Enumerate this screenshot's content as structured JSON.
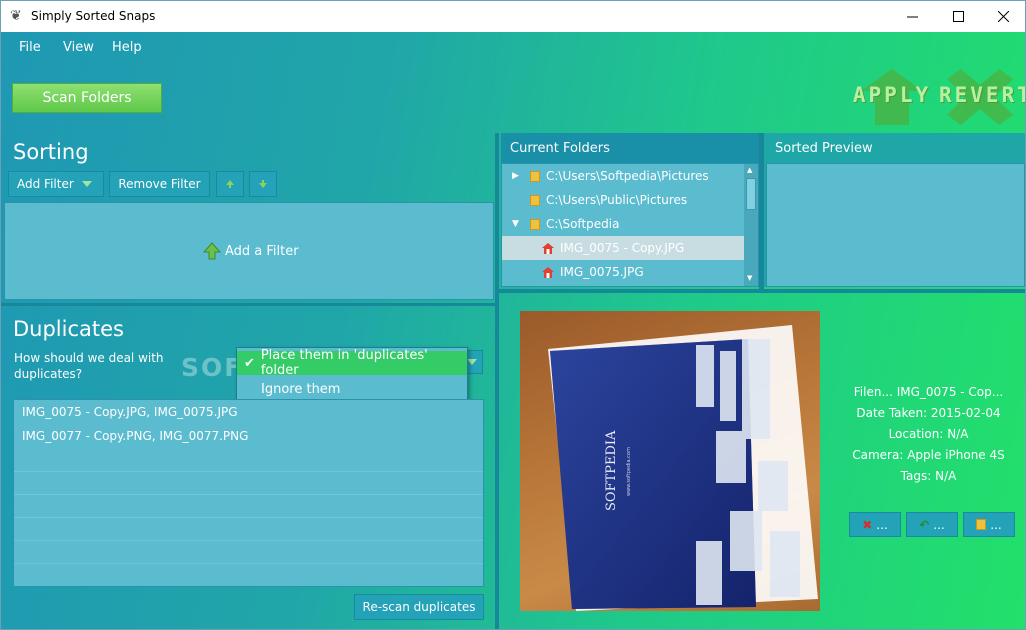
{
  "window": {
    "title": "Simply Sorted Snaps"
  },
  "menu": {
    "items": [
      "File",
      "View",
      "Help"
    ]
  },
  "toolbar": {
    "scan_label": "Scan Folders",
    "apply_label": "APPLY",
    "revert_label": "REVERT"
  },
  "sorting": {
    "heading": "Sorting",
    "add_filter": "Add Filter",
    "remove_filter": "Remove Filter",
    "placeholder": "Add a Filter"
  },
  "duplicates": {
    "heading": "Duplicates",
    "question": "How should we deal with duplicates?",
    "dropdown_options": [
      "Place them in 'duplicates' folder",
      "Ignore them"
    ],
    "selected_option": "Place them in 'duplicates' folder",
    "list": [
      "IMG_0075 - Copy.JPG, IMG_0075.JPG",
      "IMG_0077 - Copy.PNG, IMG_0077.PNG"
    ],
    "rescan_label": "Re-scan duplicates"
  },
  "current_folders": {
    "heading": "Current Folders",
    "tree": [
      {
        "label": "C:\\Users\\Softpedia\\Pictures",
        "type": "folder",
        "expander": "collapsed"
      },
      {
        "label": "C:\\Users\\Public\\Pictures",
        "type": "folder",
        "expander": "none"
      },
      {
        "label": "C:\\Softpedia",
        "type": "folder",
        "expander": "expanded"
      },
      {
        "label": "IMG_0075 - Copy.JPG",
        "type": "image",
        "selected": true
      },
      {
        "label": "IMG_0075.JPG",
        "type": "image"
      }
    ]
  },
  "sorted_preview": {
    "heading": "Sorted Preview"
  },
  "photo_info": {
    "filename": "Filen... IMG_0075 - Cop...",
    "date_taken": "Date Taken: 2015-02-04",
    "location": "Location: N/A",
    "camera": "Camera: Apple iPhone 4S",
    "tags": "Tags: N/A"
  },
  "photo_buttons": [
    "...",
    "...",
    "..."
  ],
  "photo_text": {
    "brand": "SOFTPEDIA",
    "site": "www.softpedia.com",
    "watermark": "SOFTPEDIA"
  },
  "colors": {
    "accent_green": "#5fc84a",
    "panel": "#5bbcd0",
    "dropdown_selected": "#33cc66"
  }
}
